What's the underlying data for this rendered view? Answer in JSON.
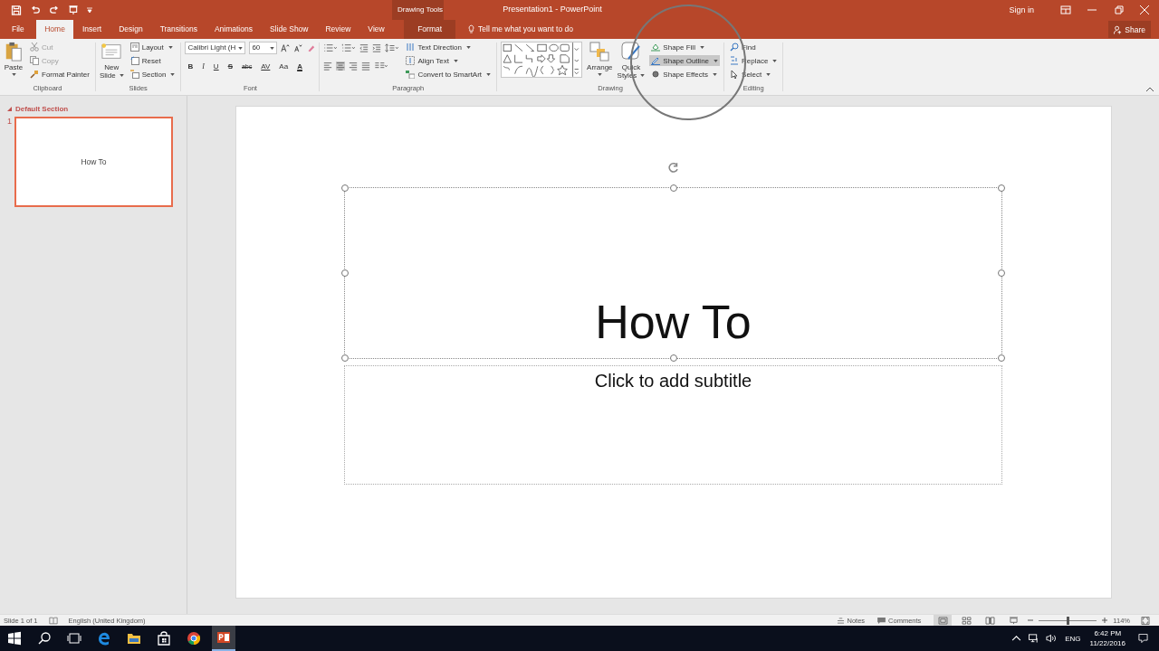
{
  "title_bar": {
    "context_label": "Drawing Tools",
    "title": "Presentation1 - PowerPoint",
    "sign_in": "Sign in"
  },
  "tabs": [
    {
      "label": "File",
      "selected": false,
      "kind": "file"
    },
    {
      "label": "Home",
      "selected": true,
      "kind": "normal"
    },
    {
      "label": "Insert",
      "selected": false,
      "kind": "normal"
    },
    {
      "label": "Design",
      "selected": false,
      "kind": "normal"
    },
    {
      "label": "Transitions",
      "selected": false,
      "kind": "normal"
    },
    {
      "label": "Animations",
      "selected": false,
      "kind": "normal"
    },
    {
      "label": "Slide Show",
      "selected": false,
      "kind": "normal"
    },
    {
      "label": "Review",
      "selected": false,
      "kind": "normal"
    },
    {
      "label": "View",
      "selected": false,
      "kind": "normal"
    },
    {
      "label": "Format",
      "selected": false,
      "kind": "contextual"
    }
  ],
  "tell_me": "Tell me what you want to do",
  "share": "Share",
  "ribbon": {
    "clipboard": {
      "label": "Clipboard",
      "paste": "Paste",
      "cut": {
        "label": "Cut",
        "disabled": true
      },
      "copy": {
        "label": "Copy",
        "disabled": true
      },
      "format_painter": {
        "label": "Format Painter",
        "disabled": false
      }
    },
    "slides": {
      "label": "Slides",
      "new_slide": [
        "New",
        "Slide"
      ],
      "layout": "Layout",
      "reset": "Reset",
      "section": "Section"
    },
    "font": {
      "label": "Font",
      "font_name": "Calibri Light (H",
      "font_size": "60",
      "styles": [
        "B",
        "I",
        "U",
        "S",
        "abc",
        "AV",
        "Aa"
      ],
      "color_letter": "A"
    },
    "paragraph": {
      "label": "Paragraph",
      "alignments": [
        {
          "selected": false
        },
        {
          "selected": true
        },
        {
          "selected": false
        },
        {
          "selected": false
        }
      ],
      "text_direction": "Text Direction",
      "align_text": "Align Text",
      "smartart": "Convert to SmartArt"
    },
    "drawing": {
      "label": "Drawing",
      "arrange": "Arrange",
      "quick_styles": [
        "Quick",
        "Styles"
      ],
      "commands": [
        {
          "label": "Shape Fill",
          "highlighted": false
        },
        {
          "label": "Shape Outline",
          "highlighted": true
        },
        {
          "label": "Shape Effects",
          "highlighted": false
        }
      ]
    },
    "editing": {
      "label": "Editing",
      "find": "Find",
      "replace": "Replace",
      "select": "Select"
    }
  },
  "sidebar": {
    "section": "Default Section",
    "slides": [
      {
        "number": "1",
        "title": "How To",
        "selected": true
      }
    ]
  },
  "slide": {
    "title": "How To",
    "title_selected": true,
    "subtitle_placeholder": "Click to add subtitle"
  },
  "status_bar": {
    "slide_count": "Slide 1 of 1",
    "language": "English (United Kingdom)",
    "notes": "Notes",
    "comments": "Comments",
    "views": [
      {
        "selected": true
      },
      {
        "selected": false
      },
      {
        "selected": false
      },
      {
        "selected": false
      }
    ],
    "zoom": {
      "level": 0.5
    },
    "zoom_percent": "114%"
  },
  "taskbar": {
    "language": "ENG",
    "time": "6:42 PM",
    "date": "11/22/2016"
  }
}
